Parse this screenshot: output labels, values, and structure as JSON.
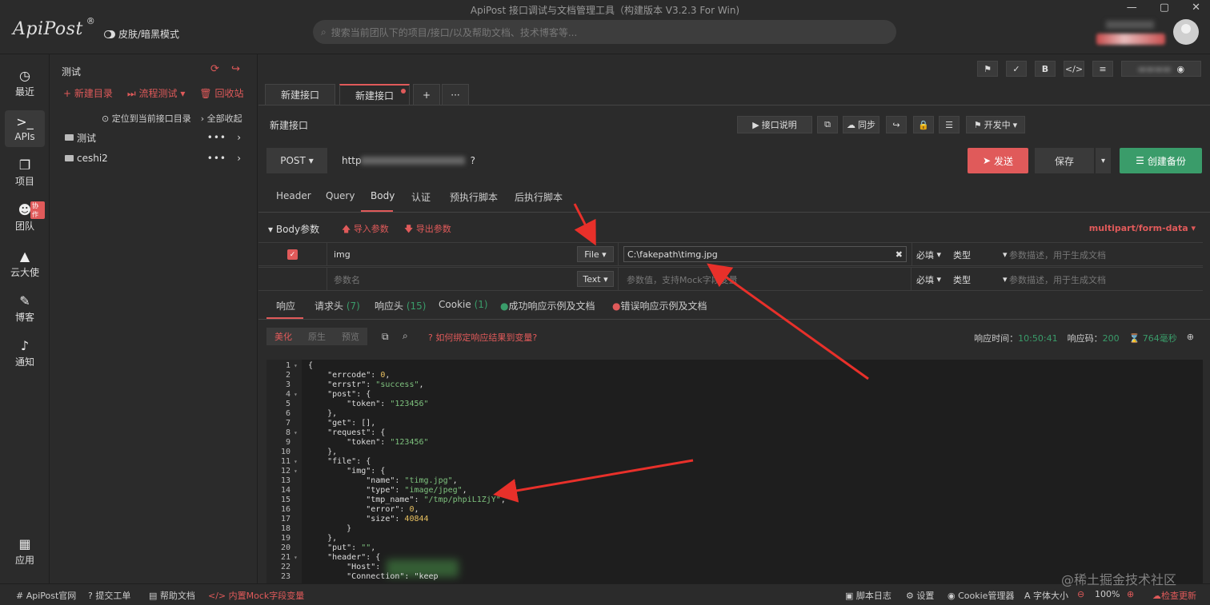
{
  "titlebar": {
    "logo": "ApiPost",
    "logo_mark": "®",
    "skin_label": "皮肤/暗黑模式",
    "app_title": "ApiPost 接口调试与文档管理工具（构建版本 V3.2.3 For Win)",
    "search_placeholder": "搜索当前团队下的项目/接口/以及帮助文档、技术博客等..."
  },
  "nav": {
    "items": [
      {
        "label": "最近",
        "icon": "clock-icon"
      },
      {
        "label": "APIs",
        "icon": "terminal-icon"
      },
      {
        "label": "项目",
        "icon": "projects-icon"
      },
      {
        "label": "团队",
        "icon": "team-icon",
        "badge": "协作"
      },
      {
        "label": "云大使",
        "icon": "graduation-icon"
      },
      {
        "label": "博客",
        "icon": "edit-icon"
      },
      {
        "label": "通知",
        "icon": "bell-icon"
      }
    ],
    "apps_label": "应用"
  },
  "tree": {
    "title": "测试",
    "new_dir": "新建目录",
    "flow_test": "流程测试",
    "recycle": "回收站",
    "locate": "定位到当前接口目录",
    "collapse": "全部收起",
    "folders": [
      {
        "name": "测试"
      },
      {
        "name": "ceshi2"
      }
    ]
  },
  "tabs": {
    "items": [
      {
        "label": "新建接口"
      },
      {
        "label": "新建接口"
      }
    ],
    "add": "+",
    "more": "···"
  },
  "request": {
    "name": "新建接口",
    "doc_btn": "接口说明",
    "sync_btn": "同步",
    "status_btn": "开发中",
    "method": "POST",
    "url": "http",
    "url_tail": "?",
    "send": "发送",
    "save": "保存",
    "backup": "创建备份",
    "subtabs": [
      "Header",
      "Query",
      "Body",
      "认证",
      "预执行脚本",
      "后执行脚本"
    ]
  },
  "body": {
    "header": "Body参数",
    "import": "导入参数",
    "export": "导出参数",
    "form_type": "multipart/form-data",
    "rows": [
      {
        "key": "img",
        "type": "File",
        "value": "C:\\fakepath\\timg.jpg",
        "required": "必填",
        "vtype": "类型",
        "desc": "参数描述，用于生成文档"
      },
      {
        "key": "参数名",
        "type": "Text",
        "value": "参数值，支持Mock字段变量",
        "required": "必填",
        "vtype": "类型",
        "desc": "参数描述，用于生成文档"
      }
    ]
  },
  "response": {
    "tabs": [
      {
        "label": "响应"
      },
      {
        "label": "请求头",
        "count": "(7)"
      },
      {
        "label": "响应头",
        "count": "(15)"
      },
      {
        "label": "Cookie",
        "count": "(1)"
      },
      {
        "label": "成功响应示例及文档"
      },
      {
        "label": "错误响应示例及文档"
      }
    ],
    "views": [
      "美化",
      "原生",
      "预览"
    ],
    "bind_hint": "如何绑定响应结果到变量?",
    "time_label": "响应时间：",
    "time_value": "10:50:41",
    "code_label": "响应码：",
    "code_value": "200",
    "duration": "764毫秒",
    "lines": [
      "{",
      "    \"errcode\": 0,",
      "    \"errstr\": \"success\",",
      "    \"post\": {",
      "        \"token\": \"123456\"",
      "    },",
      "    \"get\": [],",
      "    \"request\": {",
      "        \"token\": \"123456\"",
      "    },",
      "    \"file\": {",
      "        \"img\": {",
      "            \"name\": \"timg.jpg\",",
      "            \"type\": \"image/jpeg\",",
      "            \"tmp_name\": \"/tmp/phpiL1ZjY\",",
      "            \"error\": 0,",
      "            \"size\": 40844",
      "        }",
      "    },",
      "    \"put\": \"\",",
      "    \"header\": {",
      "        \"Host\": ",
      "        \"Connection\": \"keep"
    ]
  },
  "statusbar": {
    "official": "ApiPost官网",
    "ticket": "提交工单",
    "help": "帮助文档",
    "mock": "内置Mock字段变量",
    "log": "脚本日志",
    "settings": "设置",
    "cookie": "Cookie管理器",
    "font": "字体大小",
    "zoom": "100%",
    "update": "检查更新"
  },
  "watermark": "@稀土掘金技术社区"
}
